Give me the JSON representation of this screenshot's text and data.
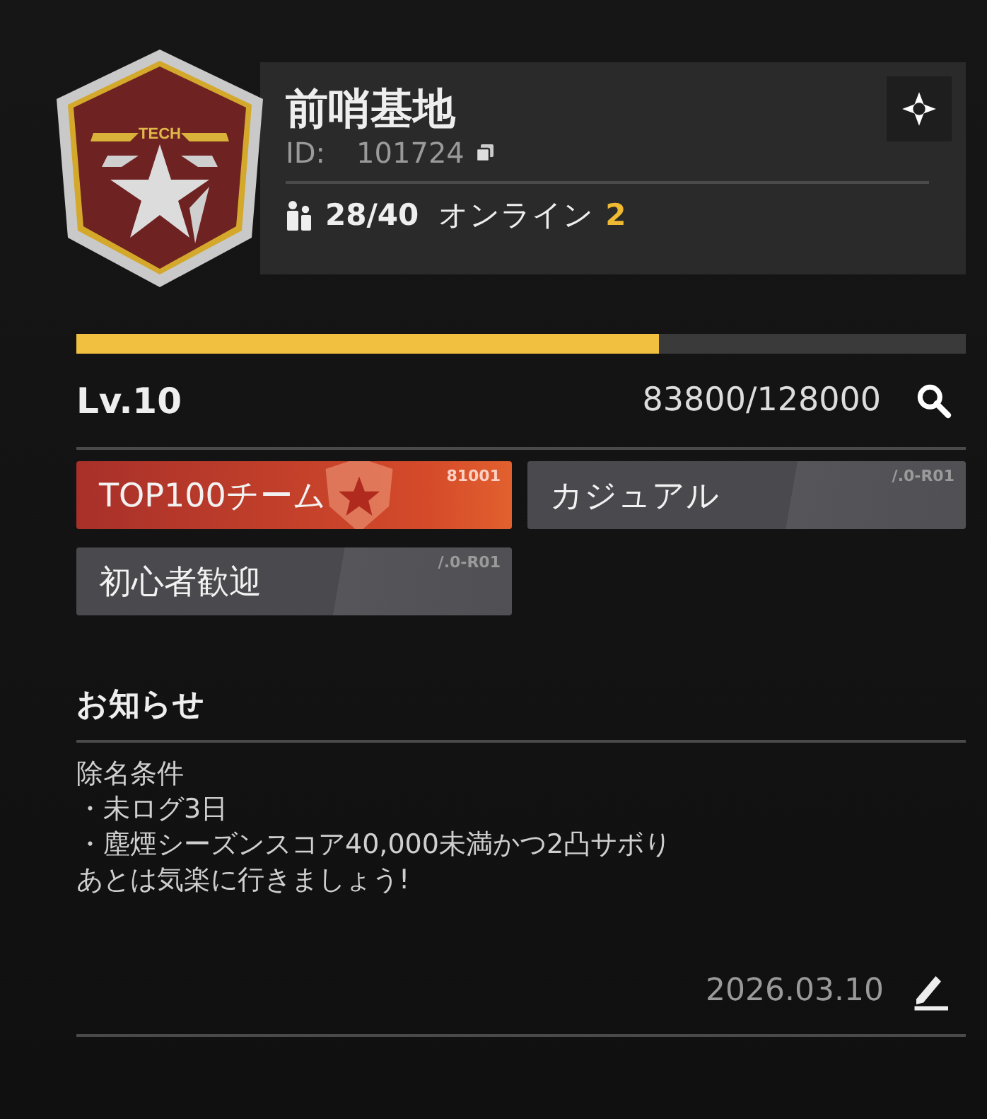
{
  "team": {
    "badge_label": "TECH",
    "name": "前哨基地",
    "id_label": "ID:",
    "id": "101724",
    "members": "28/40",
    "online_label": "オンライン",
    "online_count": "2"
  },
  "progress": {
    "level": 0.655,
    "lv": "Lv.10",
    "exp": "83800/128000"
  },
  "tags": [
    {
      "label": "TOP100チーム",
      "code": "81001",
      "kind": "rank"
    },
    {
      "label": "カジュアル",
      "code": "/.0-R01",
      "kind": "plain"
    },
    {
      "label": "初心者歓迎",
      "code": "/.0-R01",
      "kind": "plain"
    }
  ],
  "notice": {
    "title": "お知らせ",
    "lines": [
      "除名条件",
      "・未ログ3日",
      "・塵煙シーズンスコア40,000未満かつ2凸サボり",
      "あとは気楽に行きましょう!"
    ],
    "date": "2026.03.10"
  }
}
